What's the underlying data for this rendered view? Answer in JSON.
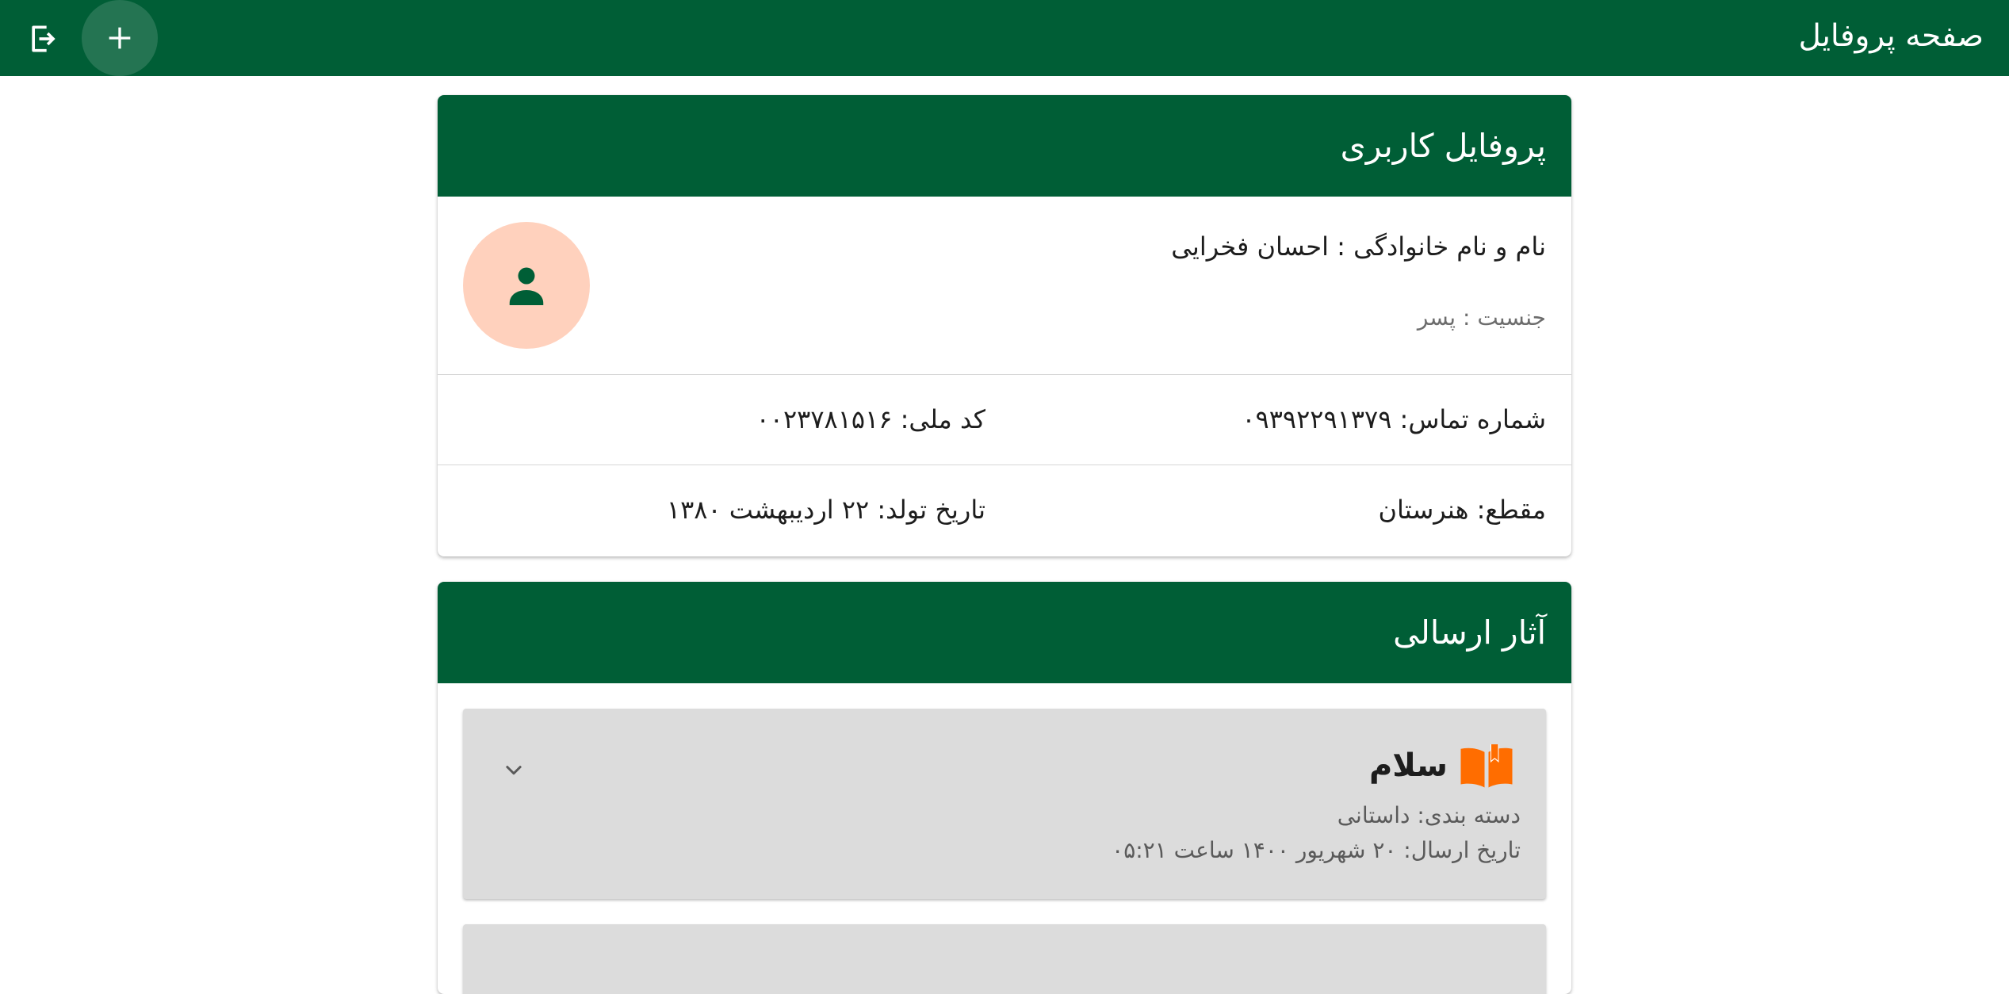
{
  "appbar": {
    "title": "صفحه پروفایل",
    "add_icon": "plus-icon",
    "logout_icon": "logout-icon"
  },
  "profile": {
    "header": "پروفایل کاربری",
    "name_line": "نام و نام خانوادگی : احسان فخرایی",
    "gender_line": "جنسیت : پسر",
    "avatar_icon": "person-icon",
    "phone": "شماره تماس: ۰۹۳۹۲۲۹۱۳۷۹",
    "national_code": "کد ملی: ۰۰۲۳۷۸۱۵۱۶",
    "grade": "مقطع: هنرستان",
    "birth_date": "تاریخ تولد: ۲۲ اردیبهشت ۱۳۸۰"
  },
  "works": {
    "header": "آثار ارسالی",
    "items": [
      {
        "title": "سلام",
        "icon": "book-icon",
        "category": "دسته بندی: داستانی",
        "sent_date": "تاریخ ارسال: ۲۰ شهریور ۱۴۰۰ ساعت ۰۵:۲۱",
        "expand_icon": "chevron-down-icon"
      }
    ]
  },
  "colors": {
    "primary": "#005e36",
    "avatar_bg": "#ffd1bd",
    "book_icon": "#ff6d00",
    "item_bg": "#dcdcdc"
  }
}
